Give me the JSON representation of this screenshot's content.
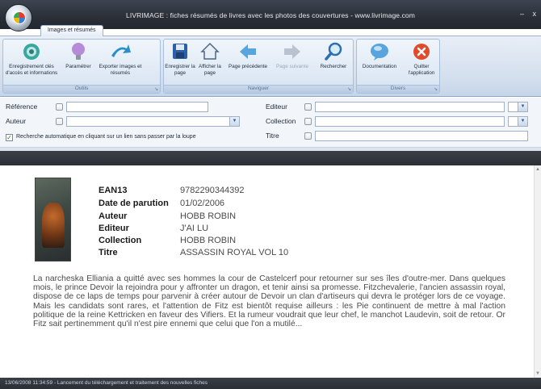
{
  "window": {
    "title": "LIVRIMAGE : fiches résumés de livres avec les photos des couvertures - www.livrimage.com",
    "minimize_glyph": "–",
    "close_glyph": "x"
  },
  "tabs": [
    {
      "label": "Images et résumés"
    }
  ],
  "ribbon": {
    "groups": {
      "outils": {
        "label": "Outils"
      },
      "naviguer": {
        "label": "Naviguer"
      },
      "divers": {
        "label": "Divers"
      }
    },
    "buttons": {
      "enregistrement": "Enregistrement clés d'accès et informations",
      "parametrer": "Paramétrer",
      "exporter": "Exporter images et résumés",
      "enregistrer_page": "Enregistrer la page",
      "afficher_page": "Afficher la page",
      "page_precedente": "Page précédente",
      "page_suivante": "Page suivante",
      "rechercher": "Rechercher",
      "documentation": "Documentation",
      "quitter": "Quitter l'application"
    }
  },
  "search": {
    "reference_label": "Référence",
    "auteur_label": "Auteur",
    "editeur_label": "Editeur",
    "collection_label": "Collection",
    "titre_label": "Titre",
    "auto_search_label": "Recherche automatique en cliquant sur un lien sans passer par la loupe",
    "reference_value": "",
    "auteur_value": "",
    "editeur_value": "",
    "collection_value": "",
    "titre_value": ""
  },
  "book": {
    "fields": [
      {
        "key": "EAN13",
        "value": "9782290344392"
      },
      {
        "key": "Date de parution",
        "value": "01/02/2006"
      },
      {
        "key": "Auteur",
        "value": "HOBB ROBIN"
      },
      {
        "key": "Editeur",
        "value": "J'AI LU"
      },
      {
        "key": "Collection",
        "value": "HOBB ROBIN"
      },
      {
        "key": "Titre",
        "value": "ASSASSIN ROYAL VOL 10"
      }
    ],
    "description": "La narcheska Elliania a quitté avec ses hommes la cour de Castelcerf pour retourner sur ses îles d'outre-mer. Dans quelques mois, le prince Devoir la rejoindra pour y affronter un dragon, et tenir ainsi sa promesse. Fitzchevalerie, l'ancien assassin royal, dispose de ce laps de temps pour parvenir à créer autour de Devoir un clan d'artiseurs qui devra le protéger lors de ce voyage. Mais les candidats sont rares, et l'attention de Fitz est bientôt requise ailleurs : les Pie continuent de mettre à mal l'action politique de la reine Kettricken en faveur des Vifiers. Et la rumeur voudrait que leur chef, le manchot Laudevin, soit de retour. Or Fitz sait pertinemment qu'il n'est pire ennemi que celui que l'on a mutilé..."
  },
  "status": {
    "text": "13/06/2008 11:34:59 - Lancement du téléchargement et traitement des nouvelles fiches"
  },
  "colors": {
    "ribbon": "#d3dfee",
    "titlebar": "#2a2f38",
    "accent": "#3a7bd5",
    "danger": "#e24a2c"
  }
}
